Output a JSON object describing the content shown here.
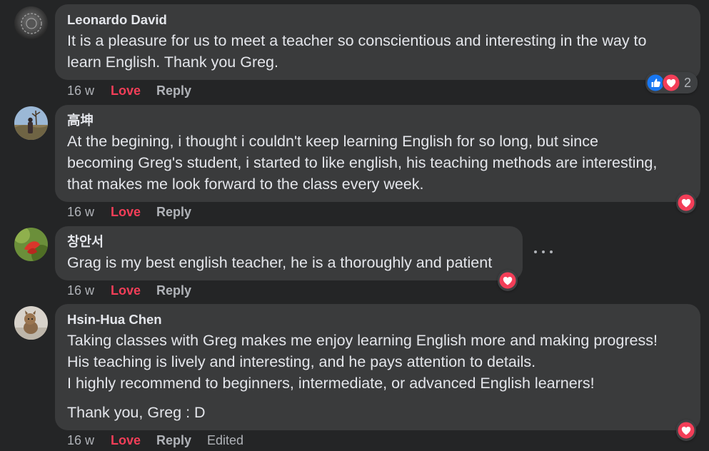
{
  "colors": {
    "background": "#242526",
    "bubble": "#3a3b3c",
    "text": "#e4e6eb",
    "secondary": "#b0b3b8",
    "love": "#f33e58",
    "like": "#1877f2"
  },
  "comments": [
    {
      "author": "Leonardo David",
      "lines": [
        "It is a pleasure for us to meet a teacher so conscientious and interesting in the way to",
        "learn English. Thank you Greg."
      ],
      "time": "16 w",
      "love_label": "Love",
      "reply_label": "Reply",
      "reactions": [
        "like-icon",
        "love-icon"
      ],
      "reaction_count": "2"
    },
    {
      "author": "高坤",
      "lines": [
        "At the begining, i thought i couldn't keep learning English for so long, but since",
        "becoming Greg's student, i started to like english, his teaching methods are interesting,",
        "that makes me look forward to the class every week."
      ],
      "time": "16 w",
      "love_label": "Love",
      "reply_label": "Reply",
      "reactions": [
        "love-icon"
      ]
    },
    {
      "author": "창안서",
      "lines": [
        "Grag is my best english teacher, he is a thoroughly and patient"
      ],
      "time": "16 w",
      "love_label": "Love",
      "reply_label": "Reply",
      "reactions": [
        "love-icon"
      ],
      "more_menu": "more-options-icon"
    },
    {
      "author": "Hsin-Hua Chen",
      "lines": [
        "Taking classes with Greg makes me enjoy learning English more and making progress!",
        "His teaching is lively and interesting, and he pays attention to details.",
        "I highly recommend to beginners, intermediate, or advanced English learners!"
      ],
      "lines_after_break": [
        "Thank you, Greg : D"
      ],
      "time": "16 w",
      "love_label": "Love",
      "reply_label": "Reply",
      "edited_label": "Edited",
      "reactions": [
        "love-icon"
      ]
    }
  ]
}
